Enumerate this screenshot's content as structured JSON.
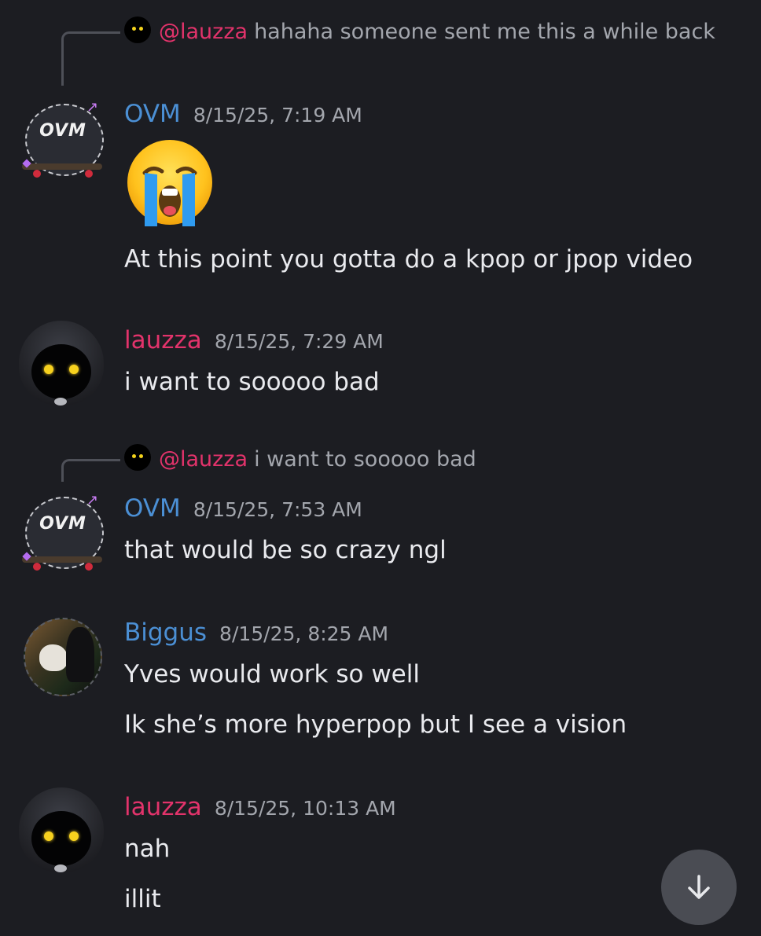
{
  "colors": {
    "background": "#1c1d22",
    "ovm": "#4b8fd4",
    "lauzza": "#e2336b",
    "biggus": "#4b8fd4",
    "mention": "#e2336b",
    "timestamp": "#a3a6ad"
  },
  "messages": [
    {
      "reply": {
        "mention": "@lauzza",
        "text": "hahaha someone sent me this a while back"
      },
      "author": "OVM",
      "timestamp": "8/15/25, 7:19 AM",
      "emoji": "loudly-crying-face",
      "lines": [
        "At this point you gotta do a kpop or jpop video"
      ]
    },
    {
      "author": "lauzza",
      "timestamp": "8/15/25, 7:29 AM",
      "lines": [
        "i want to sooooo bad"
      ]
    },
    {
      "reply": {
        "mention": "@lauzza",
        "text": "i want to sooooo bad"
      },
      "author": "OVM",
      "timestamp": "8/15/25, 7:53 AM",
      "lines": [
        "that would be so crazy ngl"
      ]
    },
    {
      "author": "Biggus",
      "timestamp": "8/15/25, 8:25 AM",
      "lines": [
        "Yves would work so well",
        "Ik she’s more hyperpop but I see a vision"
      ]
    },
    {
      "author": "lauzza",
      "timestamp": "8/15/25, 10:13 AM",
      "lines": [
        "nah",
        "illit"
      ]
    }
  ],
  "avatars": {
    "ovm_logo_text": "OVM"
  },
  "scroll_button": {
    "icon": "arrow-down-icon"
  }
}
